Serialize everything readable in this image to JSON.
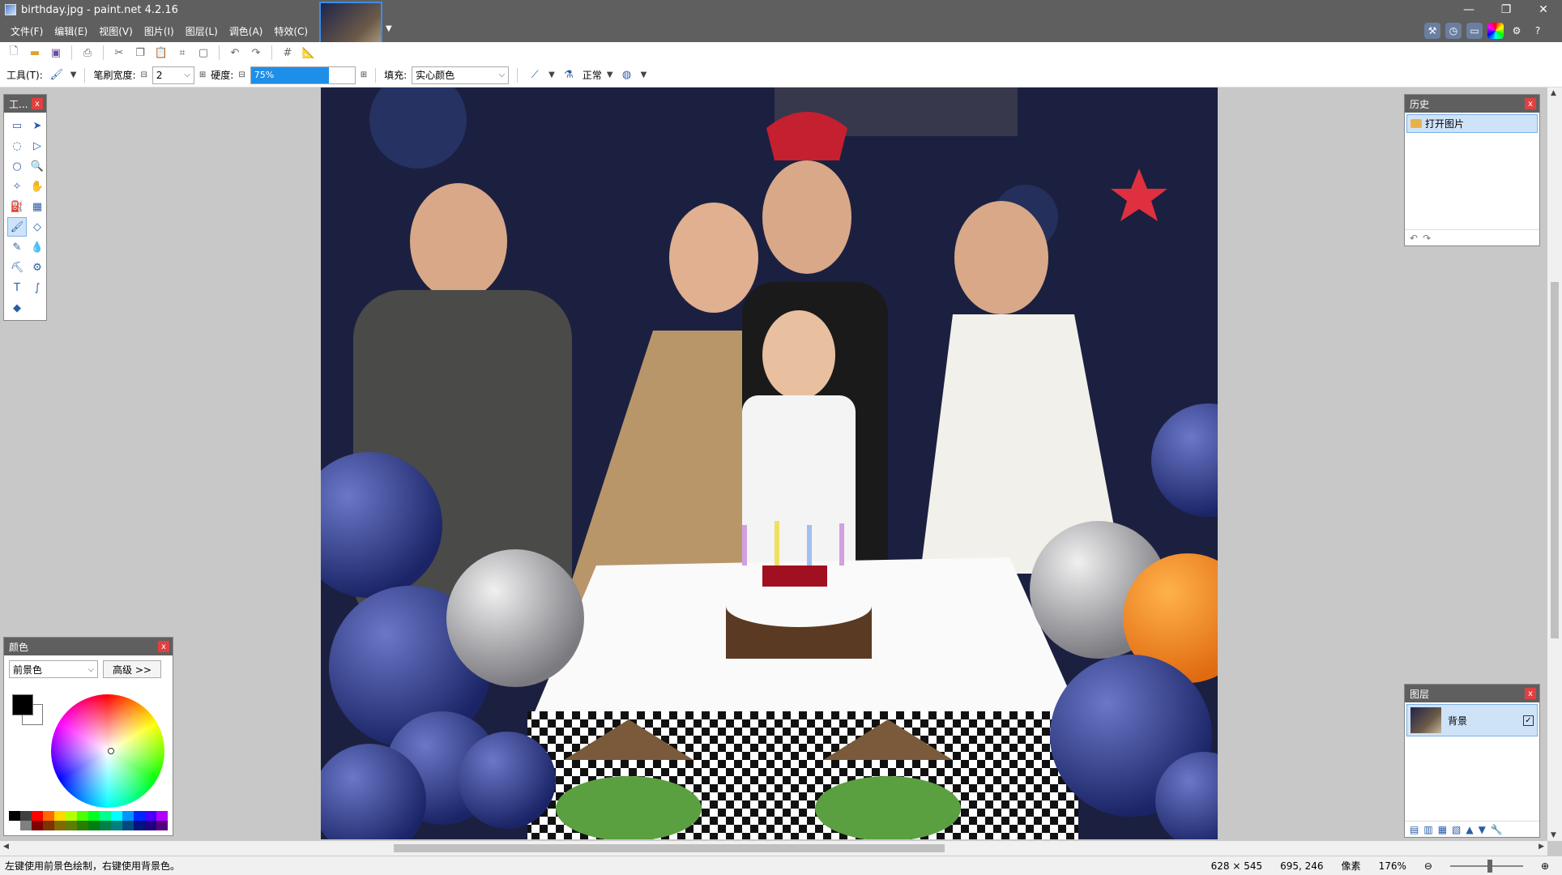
{
  "window": {
    "title": "birthday.jpg - paint.net 4.2.16",
    "min": "—",
    "max": "❐",
    "close": "✕"
  },
  "menu": [
    "文件(F)",
    "编辑(E)",
    "视图(V)",
    "图片(I)",
    "图层(L)",
    "调色(A)",
    "特效(C)"
  ],
  "toolbar2": {
    "tool_label": "工具(T):",
    "brush_width_label": "笔刷宽度:",
    "brush_width_value": "2",
    "hardness_label": "硬度:",
    "hardness_value": "75%",
    "hardness_level": 0.75,
    "fill_label": "填充:",
    "fill_value": "实心颜色",
    "blend_label": "正常"
  },
  "tools_panel": {
    "title": "工...",
    "close": "x"
  },
  "history_panel": {
    "title": "历史",
    "close": "x",
    "item": "打开图片",
    "undo": "↶",
    "redo": "↷"
  },
  "layers_panel": {
    "title": "图层",
    "close": "x",
    "layer_name": "背景",
    "checked": "✓"
  },
  "color_panel": {
    "title": "颜色",
    "close": "x",
    "mode": "前景色",
    "advanced": "高级 >>"
  },
  "status": {
    "hint": "左键使用前景色绘制，右键使用背景色。",
    "image_size": "628 × 545",
    "cursor_pos": "695, 246",
    "unit": "像素",
    "zoom": "176%"
  },
  "colors": {
    "accent": "#1e8fe8",
    "titlebar": "#5f5f5f",
    "selection": "#cfe3f8"
  }
}
